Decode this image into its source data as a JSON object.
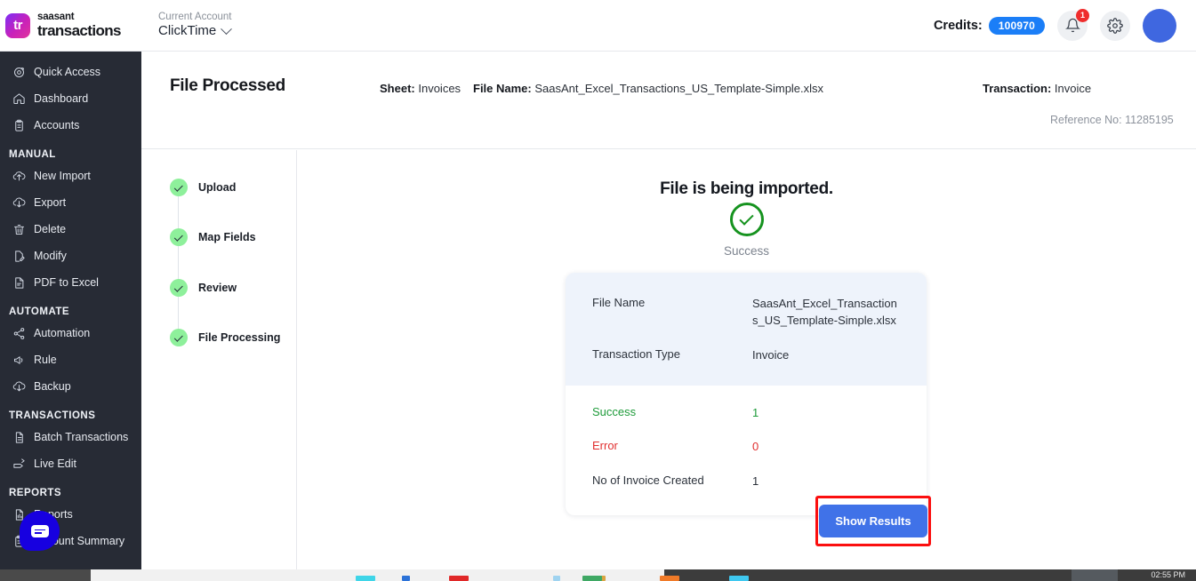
{
  "topbar": {
    "logo_text": "tr",
    "brand_line1": "saasant",
    "brand_line2": "transactions",
    "account_label": "Current Account",
    "account_value": "ClickTime",
    "credits_label": "Credits:",
    "credits_value": "100970",
    "notification_count": "1"
  },
  "sidebar": {
    "items": [
      {
        "label": "Quick Access",
        "icon": "target-icon"
      },
      {
        "label": "Dashboard",
        "icon": "home-icon"
      },
      {
        "label": "Accounts",
        "icon": "clipboard-icon"
      }
    ],
    "sections": [
      {
        "heading": "MANUAL",
        "items": [
          {
            "label": "New Import",
            "icon": "upload-cloud-icon"
          },
          {
            "label": "Export",
            "icon": "download-cloud-icon"
          },
          {
            "label": "Delete",
            "icon": "trash-icon"
          },
          {
            "label": "Modify",
            "icon": "file-edit-icon"
          },
          {
            "label": "PDF to Excel",
            "icon": "file-pdf-icon"
          }
        ]
      },
      {
        "heading": "AUTOMATE",
        "items": [
          {
            "label": "Automation",
            "icon": "share-nodes-icon"
          },
          {
            "label": "Rule",
            "icon": "megaphone-icon"
          },
          {
            "label": "Backup",
            "icon": "download-cloud-icon"
          }
        ]
      },
      {
        "heading": "TRANSACTIONS",
        "items": [
          {
            "label": "Batch Transactions",
            "icon": "document-icon"
          },
          {
            "label": "Live Edit",
            "icon": "pen-tag-icon"
          }
        ]
      },
      {
        "heading": "REPORTS",
        "items": [
          {
            "label": "Reports",
            "icon": "report-icon"
          },
          {
            "label": "Account Summary",
            "icon": "clipboard-icon"
          }
        ]
      }
    ]
  },
  "page_header": {
    "title": "File Processed",
    "sheet_label": "Sheet:",
    "sheet_value": "Invoices",
    "file_label": "File Name:",
    "file_value": "SaasAnt_Excel_Transactions_US_Template-Simple.xlsx",
    "transaction_label": "Transaction:",
    "transaction_value": "Invoice",
    "reference": "Reference No: 11285195"
  },
  "stepper": {
    "steps": [
      {
        "label": "Upload",
        "state": "complete"
      },
      {
        "label": "Map Fields",
        "state": "complete"
      },
      {
        "label": "Review",
        "state": "complete"
      },
      {
        "label": "File Processing",
        "state": "complete"
      }
    ]
  },
  "main": {
    "import_title": "File is being imported.",
    "status_text": "Success",
    "summary": {
      "top_rows": [
        {
          "key": "File Name",
          "value": "SaasAnt_Excel_Transactions_US_Template-Simple.xlsx",
          "tone": "default"
        },
        {
          "key": "Transaction Type",
          "value": "Invoice",
          "tone": "default"
        }
      ],
      "bottom_rows": [
        {
          "key": "Success",
          "value": "1",
          "tone": "green"
        },
        {
          "key": "Error",
          "value": "0",
          "tone": "red"
        },
        {
          "key": "No of Invoice Created",
          "value": "1",
          "tone": "default"
        }
      ]
    },
    "show_results_label": "Show Results"
  },
  "taskbar": {
    "clock": "02:55 PM"
  },
  "colors": {
    "sidebar_bg": "#272b35",
    "accent_blue": "#4072e8",
    "credits_pill": "#1b7ef7",
    "success_green": "#16931f",
    "step_green": "#8ef09b",
    "error_red": "#e13030",
    "highlight_red": "#fb0f0f",
    "card_top_bg": "#eef3fb",
    "chat_blue": "#1700e0"
  }
}
